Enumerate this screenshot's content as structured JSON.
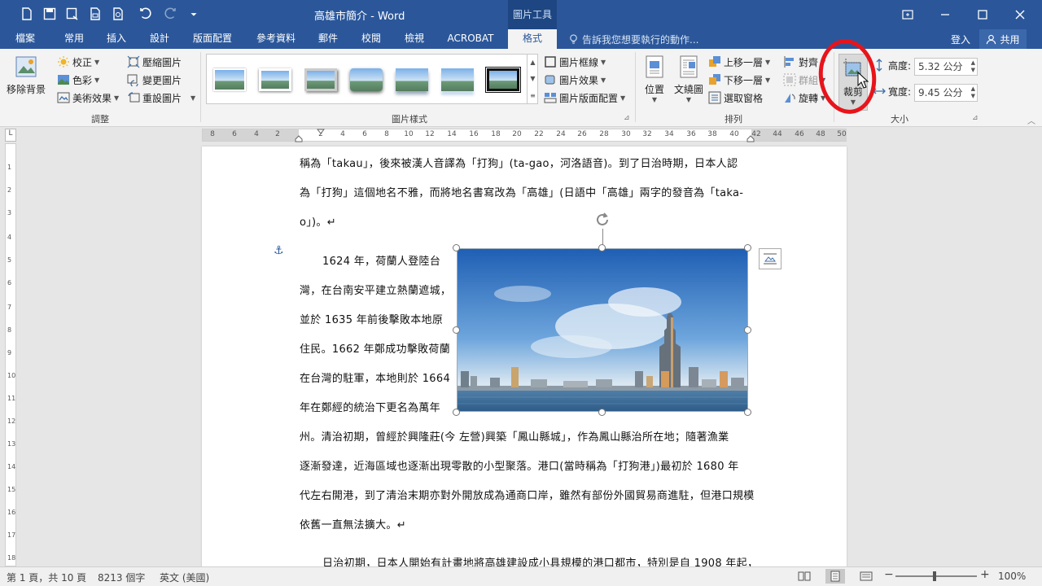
{
  "app": {
    "doc_title": "高雄市簡介 - Word",
    "context_title": "圖片工具"
  },
  "tabs": [
    {
      "label": "檔案"
    },
    {
      "label": "常用"
    },
    {
      "label": "插入"
    },
    {
      "label": "設計"
    },
    {
      "label": "版面配置"
    },
    {
      "label": "參考資料"
    },
    {
      "label": "郵件"
    },
    {
      "label": "校閱"
    },
    {
      "label": "檢視"
    },
    {
      "label": "ACROBAT"
    },
    {
      "label": "格式"
    }
  ],
  "tellme": "告訴我您想要執行的動作...",
  "signin": "登入",
  "share": "共用",
  "ribbon": {
    "remove_bg": "移除背景",
    "corrections": "校正",
    "color": "色彩",
    "artistic": "美術效果",
    "compress": "壓縮圖片",
    "change": "變更圖片",
    "reset": "重設圖片",
    "adjust_label": "調整",
    "styles_label": "圖片樣式",
    "border": "圖片框線",
    "effects": "圖片效果",
    "layout": "圖片版面配置",
    "position": "位置",
    "wrap": "文繞圖",
    "bring_forward": "上移一層",
    "send_backward": "下移一層",
    "selection_pane": "選取窗格",
    "align": "對齊",
    "group": "群組",
    "rotate": "旋轉",
    "arrange_label": "排列",
    "crop": "裁剪",
    "height_label": "高度:",
    "height_value": "5.32 公分",
    "width_label": "寬度:",
    "width_value": "9.45 公分",
    "size_label": "大小"
  },
  "ruler": {
    "numbers": [
      "8",
      "6",
      "4",
      "2",
      "2",
      "4",
      "6",
      "8",
      "10",
      "12",
      "14",
      "16",
      "18",
      "20",
      "22",
      "24",
      "26",
      "28",
      "30",
      "32",
      "34",
      "36",
      "38",
      "40",
      "42",
      "44",
      "46",
      "48",
      "50"
    ],
    "corner": "L"
  },
  "document": {
    "lines": [
      "稱為「takau」，後來被漢人音譯為「打狗」(ta-gao，河洛語音)。到了日治時期，日本人認",
      "為「打狗」這個地名不雅，而將地名書寫改為「高雄」(日語中「高雄」兩字的發音為「taka-",
      "o」)。↵",
      "1624 年，荷蘭人登陸台",
      "灣，在台南安平建立熱蘭遮城，",
      "並於 1635 年前後擊敗本地原",
      "住民。1662 年鄭成功擊敗荷蘭",
      "在台灣的駐軍，本地則於 1664",
      "年在鄭經的統治下更名為萬年",
      "州。清治初期，曾經於興隆莊(今 左營)興築「鳳山縣城」，作為鳳山縣治所在地；隨著漁業",
      "逐漸發達，近海區域也逐漸出現零散的小型聚落。港口(當時稱為「打狗港」)最初於 1680 年",
      "代左右開港，到了清治末期亦對外開放成為通商口岸，雖然有部份外國貿易商進駐，但港口規模",
      "依舊一直無法擴大。↵",
      "日治初期，日本人開始有計畫地將高雄建設成小具規模的港口都市，特別是自 1908 年起，"
    ]
  },
  "status": {
    "page": "第 1 頁，共 10 頁",
    "words": "8213 個字",
    "lang": "英文 (美國)",
    "zoom": "100%"
  },
  "colors": {
    "word_blue": "#2b579a",
    "annotation_red": "#e8141b"
  }
}
